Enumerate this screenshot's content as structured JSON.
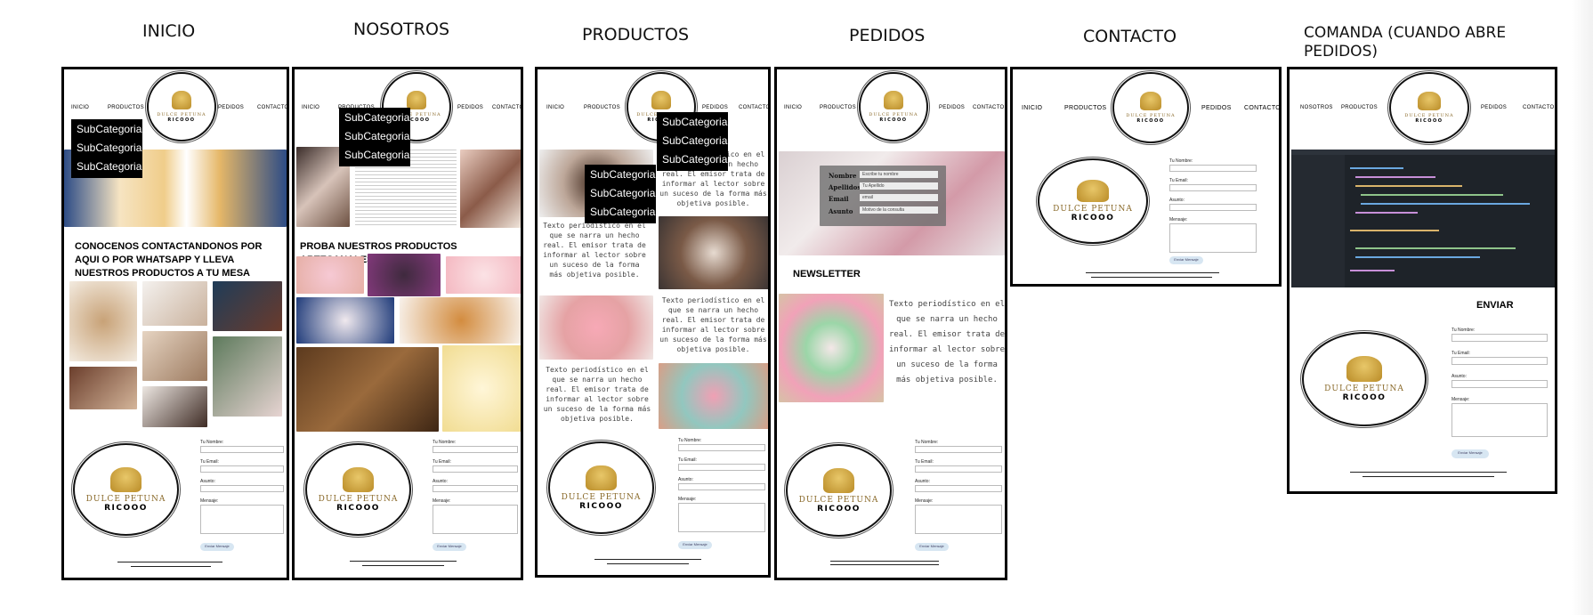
{
  "columns": [
    {
      "title": "INICIO"
    },
    {
      "title": "NOSOTROS"
    },
    {
      "title": "PRODUCTOS"
    },
    {
      "title": "PEDIDOS"
    },
    {
      "title": "CONTACTO"
    },
    {
      "title": "COMANDA (CUANDO ABRE PEDIDOS)"
    }
  ],
  "nav": {
    "inicio": "INICIO",
    "nosotros": "NOSOTROS",
    "productos": "PRODUCTOS",
    "pedidos": "PEDIDOS",
    "contacto": "CONTACTO"
  },
  "logo": {
    "brand": "DULCE PETUNA",
    "brand2": "RICOOO"
  },
  "submenu": [
    "SubCategoria",
    "SubCategoria",
    "SubCategoria"
  ],
  "inicio": {
    "headline": "CONOCENOS CONTACTANDONOS POR AQUI O POR WHATSAPP Y LLEVA NUESTROS PRODUCTOS A TU MESA"
  },
  "nosotros": {
    "headline": "PROBA NUESTROS PRODUCTOS ARTESANALES"
  },
  "productos": {
    "text": "Texto periodístico en el que se narra un hecho real. El emisor trata de informar al lector sobre un suceso de la forma más objetiva posible."
  },
  "pedidos": {
    "form_labels": {
      "nombre": "Nombre",
      "apellidos": "Apellidos",
      "email": "Email",
      "asunto": "Asunto"
    },
    "form_placeholders": {
      "nombre": "Escribe tu nombre",
      "apellidos": "Tu Apellido",
      "email": "email",
      "asunto": "Motivo de la consulta"
    },
    "newsletter": "NEWSLETTER",
    "news_text": "Texto periodístico en el que se narra un hecho real. El emisor trata de informar al lector sobre un suceso de la forma más objetiva posible."
  },
  "comanda": {
    "enviar": "ENVIAR"
  },
  "contact_form": {
    "nombre": "Tu Nombre:",
    "email": "Tu Email:",
    "asunto": "Asunto:",
    "mensaje": "Mensaje:",
    "send": "Enviar Mensaje"
  },
  "colors": {
    "gold": "#c89b3c",
    "code_bg": "#1e2329",
    "submenu_bg": "#000000"
  }
}
